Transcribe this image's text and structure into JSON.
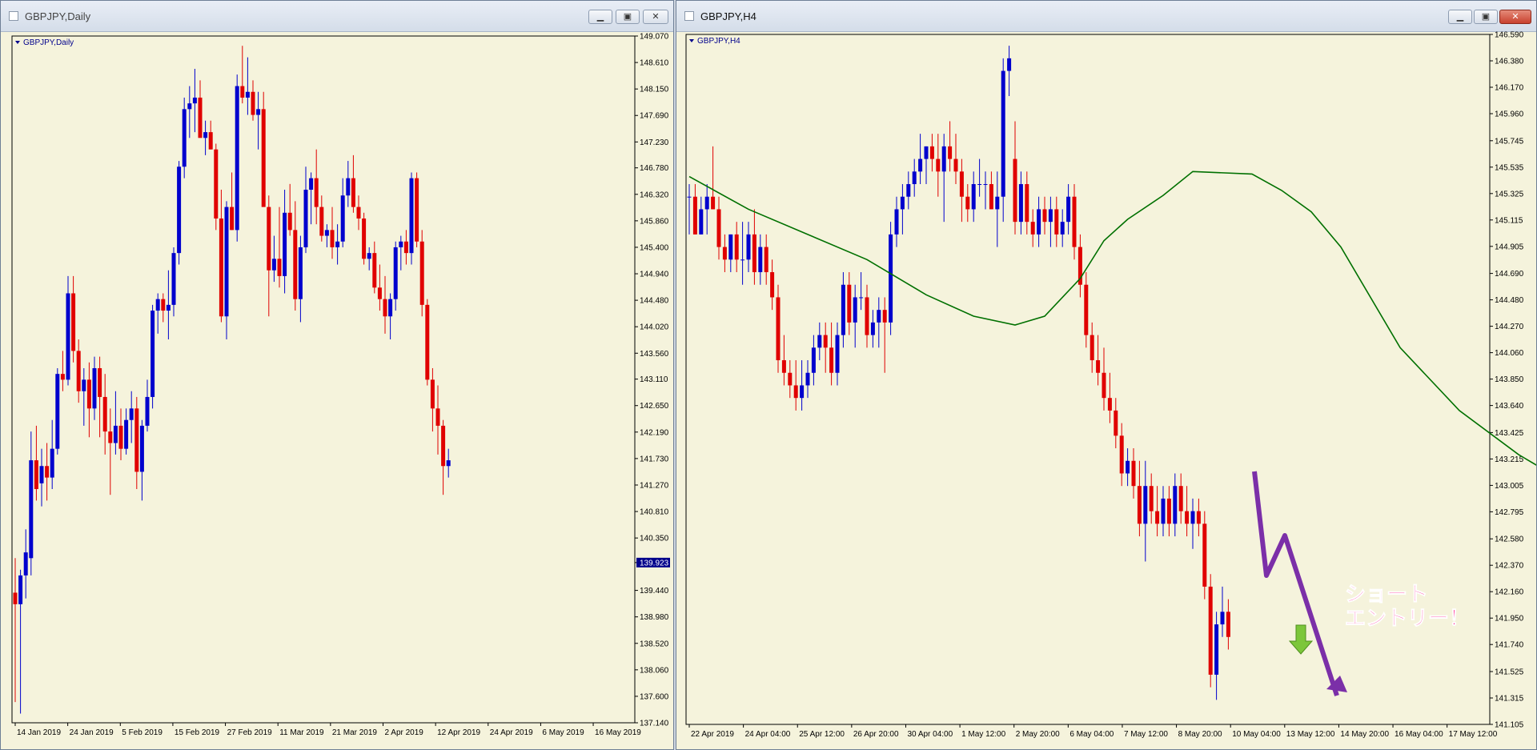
{
  "windows": {
    "left": {
      "title": "GBPJPY,Daily",
      "chart_label": "GBPJPY,Daily",
      "buttons": {
        "minimize": "▁",
        "maximize": "▣",
        "close": "✕"
      }
    },
    "right": {
      "title": "GBPJPY,H4",
      "chart_label": "GBPJPY,H4",
      "buttons": {
        "minimize": "▁",
        "maximize": "▣",
        "close": "✕"
      }
    }
  },
  "colors": {
    "background": "#f5f3dc",
    "bull": "#0000cd",
    "bear": "#e00000",
    "ma": "#007000",
    "price_label_bg": "#00008b",
    "annotation_arrow": "#7b2fa8",
    "annotation_text": "#ff1f8f",
    "entry_arrow": "#7cc63a"
  },
  "icons": [
    "chart-window-icon",
    "minimize-icon",
    "maximize-icon",
    "close-icon",
    "down-arrow-icon",
    "dropdown-triangle-icon"
  ],
  "chart_data": [
    {
      "type": "candlestick",
      "symbol": "GBPJPY",
      "timeframe": "Daily",
      "y_ticks": [
        "149.070",
        "148.610",
        "148.150",
        "147.690",
        "147.230",
        "146.780",
        "146.320",
        "145.860",
        "145.400",
        "144.940",
        "144.480",
        "144.020",
        "143.560",
        "143.110",
        "142.650",
        "142.190",
        "141.730",
        "141.270",
        "140.810",
        "140.350",
        "139.923",
        "139.440",
        "138.980",
        "138.520",
        "138.060",
        "137.600",
        "137.140"
      ],
      "current_price_label": "139.923",
      "ylim": [
        137.14,
        149.07
      ],
      "x_labels": [
        "14 Jan 2019",
        "24 Jan 2019",
        "5 Feb 2019",
        "15 Feb 2019",
        "27 Feb 2019",
        "11 Mar 2019",
        "21 Mar 2019",
        "2 Apr 2019",
        "12 Apr 2019",
        "24 Apr 2019",
        "6 May 2019",
        "16 May 2019"
      ],
      "candles_ohlc": [
        [
          139.4,
          140.0,
          137.5,
          139.2
        ],
        [
          139.2,
          139.8,
          137.3,
          139.7
        ],
        [
          139.7,
          140.5,
          139.3,
          140.1
        ],
        [
          140.0,
          142.2,
          139.7,
          141.7
        ],
        [
          141.7,
          142.3,
          141.0,
          141.2
        ],
        [
          141.3,
          141.9,
          140.9,
          141.6
        ],
        [
          141.6,
          142.0,
          141.0,
          141.4
        ],
        [
          141.4,
          142.4,
          141.2,
          141.9
        ],
        [
          141.9,
          143.3,
          141.8,
          143.2
        ],
        [
          143.2,
          143.6,
          142.9,
          143.1
        ],
        [
          143.1,
          144.9,
          143.0,
          144.6
        ],
        [
          144.6,
          144.9,
          143.4,
          143.6
        ],
        [
          143.6,
          143.8,
          142.7,
          142.9
        ],
        [
          142.9,
          143.3,
          142.3,
          143.1
        ],
        [
          143.1,
          143.4,
          142.1,
          142.6
        ],
        [
          142.6,
          143.5,
          142.4,
          143.3
        ],
        [
          143.3,
          143.5,
          142.1,
          142.8
        ],
        [
          142.8,
          143.2,
          141.8,
          142.2
        ],
        [
          142.2,
          142.6,
          141.1,
          142.0
        ],
        [
          142.0,
          142.9,
          141.8,
          142.3
        ],
        [
          142.3,
          142.6,
          141.7,
          141.9
        ],
        [
          141.9,
          142.6,
          141.8,
          142.4
        ],
        [
          142.4,
          142.9,
          142.0,
          142.6
        ],
        [
          142.6,
          142.8,
          141.2,
          141.5
        ],
        [
          141.5,
          142.4,
          141.0,
          142.3
        ],
        [
          142.3,
          143.1,
          142.2,
          142.8
        ],
        [
          142.8,
          144.4,
          142.6,
          144.3
        ],
        [
          144.3,
          144.6,
          143.9,
          144.5
        ],
        [
          144.5,
          144.6,
          144.1,
          144.3
        ],
        [
          144.3,
          145.0,
          143.8,
          144.4
        ],
        [
          144.4,
          145.4,
          144.2,
          145.3
        ],
        [
          145.3,
          146.9,
          145.1,
          146.8
        ],
        [
          146.8,
          148.0,
          146.6,
          147.8
        ],
        [
          147.8,
          148.2,
          147.3,
          147.9
        ],
        [
          147.9,
          148.5,
          147.4,
          148.0
        ],
        [
          148.0,
          148.3,
          147.5,
          147.3
        ],
        [
          147.3,
          147.6,
          147.0,
          147.4
        ],
        [
          147.4,
          147.6,
          147.1,
          147.1
        ],
        [
          147.1,
          147.2,
          145.7,
          145.9
        ],
        [
          145.9,
          146.4,
          144.1,
          144.2
        ],
        [
          144.2,
          146.2,
          143.8,
          146.1
        ],
        [
          146.1,
          146.7,
          145.7,
          145.7
        ],
        [
          145.7,
          148.4,
          145.5,
          148.2
        ],
        [
          148.2,
          148.9,
          147.9,
          148.0
        ],
        [
          148.0,
          148.7,
          147.7,
          148.1
        ],
        [
          148.1,
          148.3,
          147.6,
          147.7
        ],
        [
          147.7,
          148.1,
          147.1,
          147.8
        ],
        [
          147.8,
          148.1,
          146.6,
          146.1
        ],
        [
          146.1,
          146.3,
          144.2,
          145.0
        ],
        [
          145.0,
          145.6,
          144.8,
          145.2
        ],
        [
          145.2,
          146.1,
          144.7,
          144.9
        ],
        [
          144.9,
          146.4,
          144.6,
          146.0
        ],
        [
          146.0,
          146.5,
          145.6,
          145.7
        ],
        [
          145.7,
          146.2,
          144.3,
          144.5
        ],
        [
          144.5,
          145.6,
          144.1,
          145.4
        ],
        [
          145.4,
          146.8,
          145.3,
          146.4
        ],
        [
          146.4,
          146.7,
          145.8,
          146.6
        ],
        [
          146.6,
          147.1,
          145.8,
          146.1
        ],
        [
          146.1,
          146.3,
          145.5,
          145.6
        ],
        [
          145.6,
          145.8,
          145.4,
          145.7
        ],
        [
          145.7,
          146.1,
          145.2,
          145.4
        ],
        [
          145.4,
          145.8,
          145.1,
          145.5
        ],
        [
          145.5,
          146.6,
          145.4,
          146.3
        ],
        [
          146.3,
          146.9,
          146.1,
          146.6
        ],
        [
          146.6,
          147.0,
          146.0,
          146.1
        ],
        [
          146.1,
          146.3,
          145.7,
          145.9
        ],
        [
          145.9,
          146.0,
          145.1,
          145.2
        ],
        [
          145.2,
          145.4,
          145.0,
          145.3
        ],
        [
          145.3,
          145.5,
          144.6,
          144.7
        ],
        [
          144.7,
          145.1,
          144.3,
          144.5
        ],
        [
          144.5,
          144.9,
          143.9,
          144.2
        ],
        [
          144.2,
          144.6,
          143.8,
          144.5
        ],
        [
          144.5,
          145.5,
          144.3,
          145.4
        ],
        [
          145.4,
          145.6,
          145.0,
          145.5
        ],
        [
          145.5,
          145.7,
          145.1,
          145.3
        ],
        [
          145.3,
          146.7,
          145.1,
          146.6
        ],
        [
          146.6,
          146.7,
          145.4,
          145.5
        ],
        [
          145.5,
          145.7,
          144.2,
          144.4
        ],
        [
          144.4,
          144.5,
          143.0,
          143.1
        ],
        [
          143.1,
          143.3,
          142.2,
          142.6
        ],
        [
          142.6,
          143.0,
          141.8,
          142.3
        ],
        [
          142.3,
          142.4,
          141.1,
          141.6
        ],
        [
          141.6,
          141.9,
          141.4,
          141.7
        ]
      ]
    },
    {
      "type": "candlestick",
      "symbol": "GBPJPY",
      "timeframe": "H4",
      "y_ticks": [
        "146.590",
        "146.380",
        "146.170",
        "145.960",
        "145.745",
        "145.535",
        "145.325",
        "145.115",
        "144.905",
        "144.690",
        "144.480",
        "144.270",
        "144.060",
        "143.850",
        "143.640",
        "143.425",
        "143.215",
        "143.005",
        "142.795",
        "142.580",
        "142.370",
        "142.160",
        "141.950",
        "141.740",
        "141.525",
        "141.315",
        "141.105"
      ],
      "ylim": [
        141.105,
        146.59
      ],
      "x_labels": [
        "22 Apr 2019",
        "24 Apr 04:00",
        "25 Apr 12:00",
        "26 Apr 20:00",
        "30 Apr 04:00",
        "1 May 12:00",
        "2 May 20:00",
        "6 May 04:00",
        "7 May 12:00",
        "8 May 20:00",
        "10 May 04:00",
        "13 May 12:00",
        "14 May 20:00",
        "16 May 04:00",
        "17 May 12:00"
      ],
      "moving_average_series": {
        "x_index": [
          0,
          10,
          20,
          30,
          40,
          48,
          55,
          60,
          66,
          70,
          74,
          80,
          85,
          95,
          100,
          105,
          110,
          120,
          130,
          140,
          150,
          158,
          162
        ],
        "values": [
          145.46,
          145.2,
          145.0,
          144.8,
          144.52,
          144.35,
          144.28,
          144.35,
          144.65,
          144.95,
          145.12,
          145.31,
          145.5,
          145.48,
          145.35,
          145.18,
          144.9,
          144.1,
          143.6,
          143.25,
          142.97,
          142.55,
          142.42
        ]
      },
      "candles_ohlc": [
        [
          145.3,
          145.4,
          145.0,
          145.3
        ],
        [
          145.3,
          145.4,
          145.0,
          145.0
        ],
        [
          145.0,
          145.3,
          145.0,
          145.2
        ],
        [
          145.2,
          145.4,
          145.0,
          145.3
        ],
        [
          145.3,
          145.7,
          145.2,
          145.2
        ],
        [
          145.2,
          145.3,
          144.8,
          144.9
        ],
        [
          144.9,
          145.0,
          144.7,
          144.8
        ],
        [
          144.8,
          145.0,
          144.7,
          145.0
        ],
        [
          145.0,
          145.1,
          144.7,
          144.8
        ],
        [
          144.8,
          145.1,
          144.6,
          144.8
        ],
        [
          144.8,
          145.1,
          144.7,
          145.0
        ],
        [
          145.0,
          145.2,
          144.6,
          144.7
        ],
        [
          144.7,
          145.0,
          144.6,
          144.9
        ],
        [
          144.9,
          145.0,
          144.6,
          144.7
        ],
        [
          144.7,
          144.8,
          144.4,
          144.5
        ],
        [
          144.5,
          144.6,
          143.9,
          144.0
        ],
        [
          144.0,
          144.2,
          143.8,
          143.9
        ],
        [
          143.9,
          144.0,
          143.7,
          143.8
        ],
        [
          143.8,
          144.0,
          143.6,
          143.7
        ],
        [
          143.7,
          144.0,
          143.6,
          143.8
        ],
        [
          143.8,
          144.0,
          143.7,
          143.9
        ],
        [
          143.9,
          144.2,
          143.8,
          144.1
        ],
        [
          144.1,
          144.3,
          144.0,
          144.2
        ],
        [
          144.2,
          144.3,
          143.9,
          144.1
        ],
        [
          144.1,
          144.3,
          143.8,
          143.9
        ],
        [
          143.9,
          144.3,
          143.8,
          144.2
        ],
        [
          144.2,
          144.7,
          144.1,
          144.6
        ],
        [
          144.6,
          144.7,
          144.2,
          144.3
        ],
        [
          144.3,
          144.6,
          144.1,
          144.5
        ],
        [
          144.5,
          144.7,
          144.4,
          144.5
        ],
        [
          144.5,
          144.6,
          144.1,
          144.2
        ],
        [
          144.2,
          144.4,
          144.1,
          144.3
        ],
        [
          144.3,
          144.5,
          144.1,
          144.4
        ],
        [
          144.4,
          144.5,
          143.9,
          144.3
        ],
        [
          144.3,
          145.1,
          144.2,
          145.0
        ],
        [
          145.0,
          145.3,
          144.9,
          145.2
        ],
        [
          145.2,
          145.4,
          145.0,
          145.3
        ],
        [
          145.3,
          145.5,
          145.2,
          145.4
        ],
        [
          145.4,
          145.6,
          145.3,
          145.5
        ],
        [
          145.5,
          145.8,
          145.4,
          145.6
        ],
        [
          145.6,
          145.7,
          145.4,
          145.7
        ],
        [
          145.7,
          145.8,
          145.5,
          145.6
        ],
        [
          145.6,
          145.8,
          145.3,
          145.5
        ],
        [
          145.5,
          145.8,
          145.1,
          145.7
        ],
        [
          145.7,
          145.9,
          145.5,
          145.6
        ],
        [
          145.6,
          145.8,
          145.4,
          145.5
        ],
        [
          145.5,
          145.6,
          145.1,
          145.3
        ],
        [
          145.3,
          145.4,
          145.1,
          145.2
        ],
        [
          145.2,
          145.5,
          145.1,
          145.4
        ],
        [
          145.4,
          145.6,
          145.3,
          145.4
        ],
        [
          145.4,
          145.5,
          145.2,
          145.4
        ],
        [
          145.4,
          145.5,
          145.2,
          145.2
        ],
        [
          145.2,
          145.5,
          144.9,
          145.3
        ],
        [
          145.3,
          146.4,
          145.1,
          146.3
        ],
        [
          146.3,
          146.5,
          146.1,
          146.4
        ],
        [
          145.6,
          145.9,
          145.0,
          145.1
        ],
        [
          145.1,
          145.5,
          145.0,
          145.4
        ],
        [
          145.4,
          145.5,
          145.0,
          145.1
        ],
        [
          145.1,
          145.2,
          144.9,
          145.0
        ],
        [
          145.0,
          145.3,
          144.9,
          145.2
        ],
        [
          145.2,
          145.3,
          145.0,
          145.1
        ],
        [
          145.1,
          145.3,
          144.9,
          145.2
        ],
        [
          145.2,
          145.3,
          144.9,
          145.0
        ],
        [
          145.0,
          145.2,
          144.9,
          145.1
        ],
        [
          145.1,
          145.4,
          145.0,
          145.3
        ],
        [
          145.3,
          145.4,
          144.8,
          144.9
        ],
        [
          144.9,
          145.0,
          144.5,
          144.6
        ],
        [
          144.6,
          144.7,
          144.1,
          144.2
        ],
        [
          144.2,
          144.3,
          143.9,
          144.0
        ],
        [
          144.0,
          144.2,
          143.8,
          143.9
        ],
        [
          143.9,
          144.1,
          143.6,
          143.7
        ],
        [
          143.7,
          143.9,
          143.5,
          143.6
        ],
        [
          143.6,
          143.7,
          143.3,
          143.4
        ],
        [
          143.4,
          143.5,
          143.0,
          143.1
        ],
        [
          143.1,
          143.3,
          143.0,
          143.2
        ],
        [
          143.2,
          143.3,
          142.9,
          143.0
        ],
        [
          143.0,
          143.2,
          142.6,
          142.7
        ],
        [
          142.7,
          143.2,
          142.4,
          143.0
        ],
        [
          143.0,
          143.1,
          142.7,
          142.8
        ],
        [
          142.8,
          143.0,
          142.6,
          142.7
        ],
        [
          142.7,
          143.0,
          142.6,
          142.9
        ],
        [
          142.9,
          143.0,
          142.6,
          142.7
        ],
        [
          142.7,
          143.1,
          142.6,
          143.0
        ],
        [
          143.0,
          143.1,
          142.7,
          142.8
        ],
        [
          142.8,
          143.0,
          142.6,
          142.7
        ],
        [
          142.7,
          142.9,
          142.5,
          142.8
        ],
        [
          142.8,
          142.9,
          142.6,
          142.7
        ],
        [
          142.7,
          142.8,
          142.1,
          142.2
        ],
        [
          142.2,
          142.3,
          141.4,
          141.5
        ],
        [
          141.5,
          142.0,
          141.3,
          141.9
        ],
        [
          141.9,
          142.2,
          141.8,
          142.0
        ],
        [
          142.0,
          142.1,
          141.7,
          141.8
        ]
      ]
    }
  ],
  "annotations": {
    "text_line1": "ショート",
    "text_line2": "エントリー！"
  }
}
